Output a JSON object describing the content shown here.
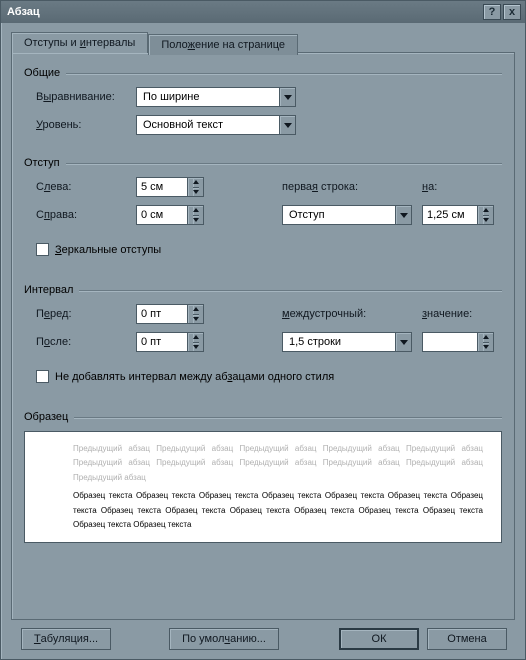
{
  "title": "Абзац",
  "titlebar": {
    "help": "?",
    "close": "x"
  },
  "tabs": {
    "indents": "Отступы и интервалы",
    "position": "Положение на странице"
  },
  "groups": {
    "general": "Общие",
    "indent": "Отступ",
    "spacing": "Интервал",
    "preview": "Образец"
  },
  "general": {
    "alignment_label": "Выравнивание:",
    "alignment_value": "По ширине",
    "level_label": "Уровень:",
    "level_value": "Основной текст"
  },
  "indent": {
    "left_label": "Слева:",
    "left_value": "5 см",
    "right_label": "Справа:",
    "right_value": "0 см",
    "first_line_label": "первая строка:",
    "first_line_value": "Отступ",
    "by_label": "на:",
    "by_value": "1,25 см",
    "mirror_label": "Зеркальные отступы"
  },
  "spacing": {
    "before_label": "Перед:",
    "before_value": "0 пт",
    "after_label": "После:",
    "after_value": "0 пт",
    "line_label": "междустрочный:",
    "line_value": "1,5 строки",
    "at_label": "значение:",
    "at_value": "",
    "no_space_label": "Не добавлять интервал между абзацами одного стиля"
  },
  "preview": {
    "gray": "Предыдущий абзац Предыдущий абзац Предыдущий абзац Предыдущий абзац Предыдущий абзац Предыдущий абзац Предыдущий абзац Предыдущий абзац Предыдущий абзац Предыдущий абзац Предыдущий абзац",
    "black": "Образец текста Образец текста Образец текста Образец текста Образец текста Образец текста Образец текста Образец текста Образец текста Образец текста Образец текста Образец текста Образец текста Образец текста Образец текста"
  },
  "buttons": {
    "tabs": "Табуляция...",
    "default": "По умолчанию...",
    "ok": "ОК",
    "cancel": "Отмена"
  }
}
